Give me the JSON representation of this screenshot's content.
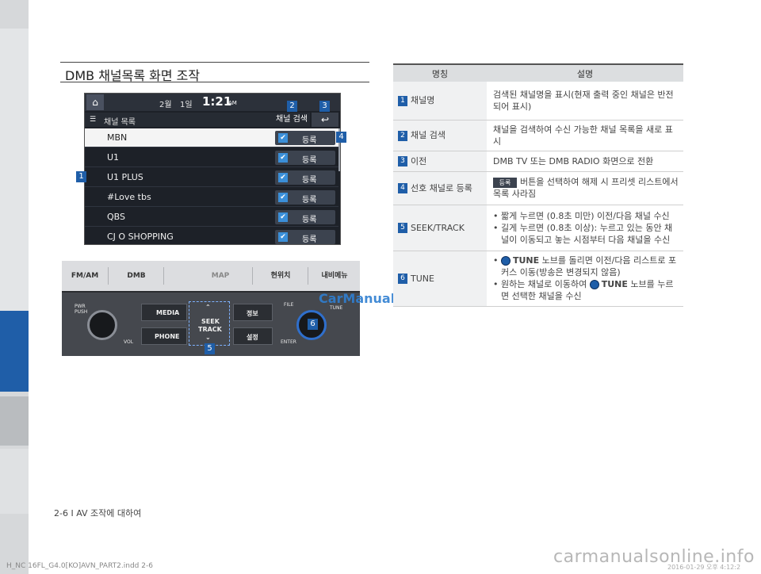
{
  "section_title": "DMB 채널목록 화면 조작",
  "screen": {
    "status": {
      "month": "2월",
      "day": "1일",
      "time": "1:21",
      "ampm": "AM"
    },
    "list_icon": "list-icon",
    "list_title": "채널 목록",
    "search_button": "채널 검색",
    "back_icon": "back-arrow-icon",
    "register_label": "등록",
    "channels": [
      "MBN",
      "U1",
      "U1 PLUS",
      "#Love tbs",
      "QBS",
      "CJ O SHOPPING"
    ]
  },
  "markers": {
    "m1": "1",
    "m2": "2",
    "m3": "3",
    "m4": "4",
    "m5": "5",
    "m6": "6"
  },
  "panel": {
    "top_keys": [
      "FM/AM",
      "DMB",
      "MAP",
      "현위치",
      "내비메뉴"
    ],
    "pwr": "PWR",
    "push": "PUSH",
    "vol": "VOL",
    "media": "MEDIA",
    "phone": "PHONE",
    "seek1": "SEEK",
    "seek2": "TRACK",
    "info": "정보",
    "setup": "설정",
    "file": "FILE",
    "tune": "TUNE",
    "enter": "ENTER"
  },
  "table": {
    "head_name": "명칭",
    "head_desc": "설명",
    "rows": [
      {
        "no": "1",
        "name": "채널명",
        "desc": [
          "검색된 채널명을 표시(현재 출력 중인 채널은 반전되어 표시)"
        ]
      },
      {
        "no": "2",
        "name": "채널 검색",
        "desc": [
          "채널을 검색하여 수신 가능한 채널 목록을 새로 표시"
        ]
      },
      {
        "no": "3",
        "name": "이전",
        "desc": [
          "DMB TV 또는 DMB RADIO 화면으로 전환"
        ]
      },
      {
        "no": "4",
        "name": "선호 채널로 등록",
        "btn": "등록",
        "desc": [
          "버튼을 선택하여 해제 시 프리셋 리스트에서 목록 사라짐"
        ]
      },
      {
        "no": "5",
        "name": "SEEK/TRACK",
        "desc": [
          "짧게 누르면 (0.8초 미만) 이전/다음 채널 수신",
          "길게 누르면 (0.8초 이상): 누르고 있는 동안 채널이 이동되고 놓는 시점부터 다음 채널을 수신"
        ]
      },
      {
        "no": "6",
        "name": "TUNE",
        "knob": "TUNE",
        "desc": [
          "노브를 돌리면 이전/다음 리스트로 포커스 이동(방송은 변경되지 않음)",
          "원하는 채널로 이동하여",
          "노브를 누르면 선택한 채널을 수신"
        ]
      }
    ]
  },
  "watermark": "CarManuals2.com",
  "footer_note": "2-6 I AV 조작에 대하여",
  "bottom_left": "H_NC 16FL_G4.0[KO]AVN_PART2.indd   2-6",
  "bottom_right": "2016-01-29  오후 4:12:2",
  "site_watermark": "carmanualsonline.info"
}
